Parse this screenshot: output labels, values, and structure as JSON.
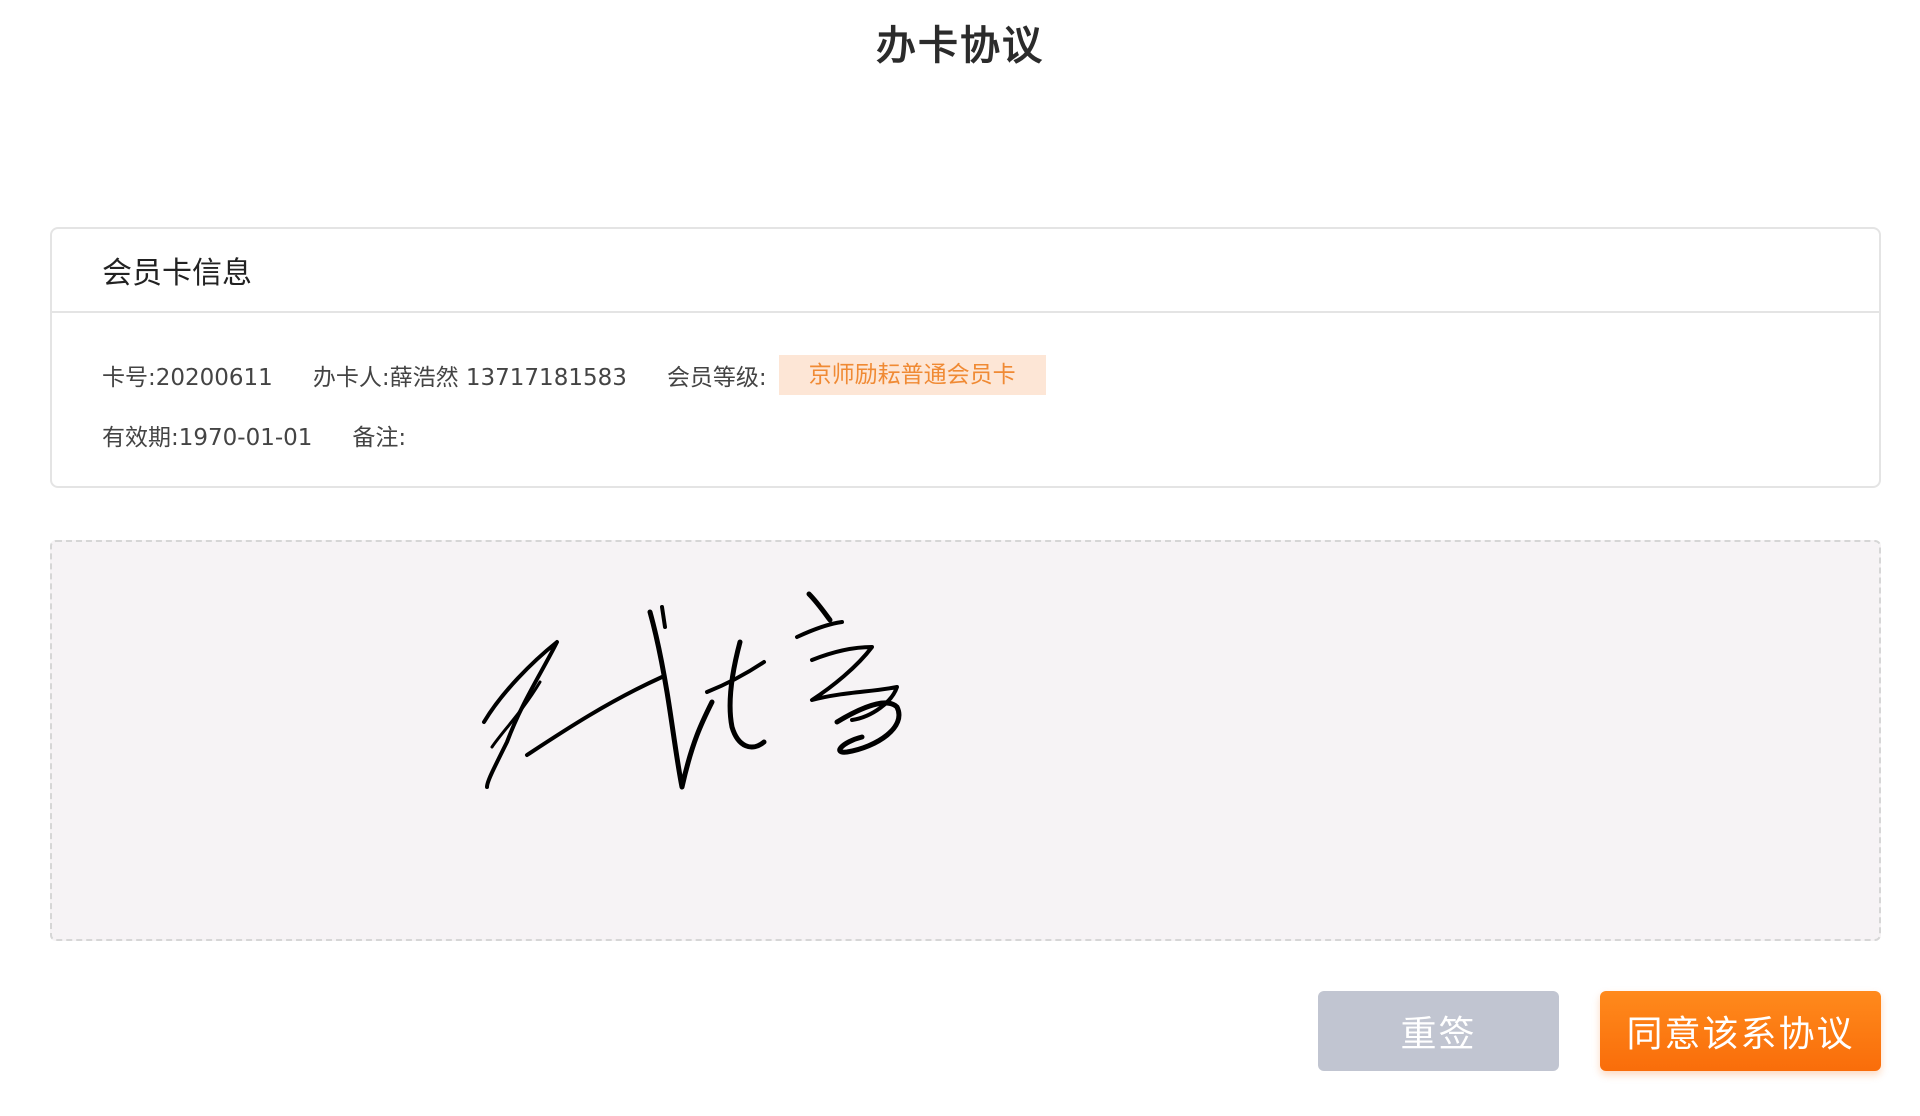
{
  "page": {
    "title": "办卡协议"
  },
  "card_info": {
    "title": "会员卡信息",
    "card_no": "卡号:20200611",
    "applicant": "办卡人:薛浩然 13717181583",
    "level_label": "会员等级:",
    "level_value": "京师励耘普通会员卡",
    "validity": "有效期:1970-01-01",
    "remark": "备注:"
  },
  "signature_pad": {
    "signature_text": "代培"
  },
  "actions": {
    "resign_label": "重签",
    "agree_label": "同意该系协议"
  },
  "colors": {
    "accent": "#f96d0a",
    "badge_bg": "#fde6d6",
    "badge_text": "#f08a34",
    "resign_bg": "#c1c5d1",
    "sign_area_bg": "#f6f3f5"
  }
}
